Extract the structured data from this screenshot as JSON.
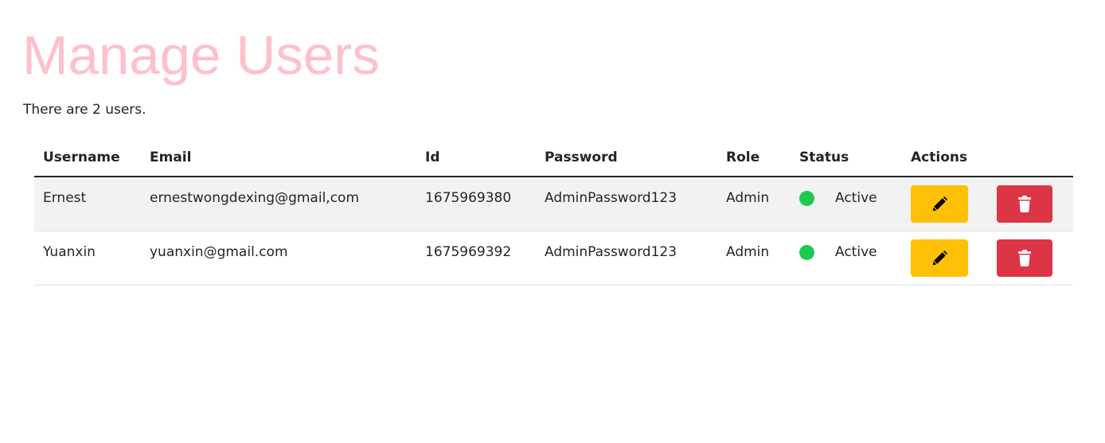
{
  "page": {
    "title": "Manage Users",
    "summary": "There are 2 users."
  },
  "table": {
    "headers": {
      "username": "Username",
      "email": "Email",
      "id": "Id",
      "password": "Password",
      "role": "Role",
      "status": "Status",
      "actions": "Actions"
    },
    "rows": [
      {
        "username": "Ernest",
        "email": "ernestwongdexing@gmail,com",
        "id": "1675969380",
        "password": "AdminPassword123",
        "role": "Admin",
        "status": "Active"
      },
      {
        "username": "Yuanxin",
        "email": "yuanxin@gmail.com",
        "id": "1675969392",
        "password": "AdminPassword123",
        "role": "Admin",
        "status": "Active"
      }
    ]
  },
  "icons": {
    "edit": "pencil-icon",
    "delete": "trash-icon",
    "status": "status-dot"
  },
  "colors": {
    "title": "#ffc0cb",
    "edit_button": "#ffc107",
    "delete_button": "#dc3545",
    "status_active": "#20c84f",
    "striped_row": "#f2f2f2"
  }
}
